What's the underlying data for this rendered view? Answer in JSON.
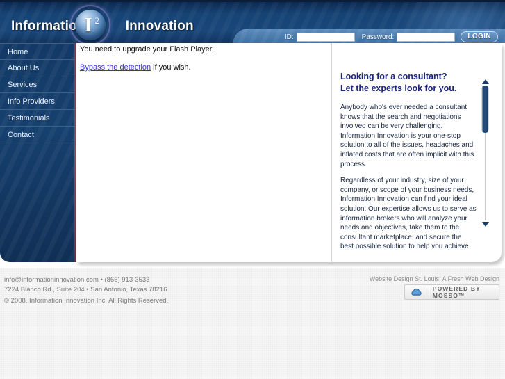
{
  "header": {
    "brand_left": "Information",
    "brand_right": "Innovation",
    "logo_letter": "I",
    "logo_superscript": "2",
    "login": {
      "id_label": "ID:",
      "id_value": "",
      "id_placeholder": "",
      "password_label": "Password:",
      "password_value": "",
      "password_placeholder": "",
      "button_label": "LOGIN"
    }
  },
  "sidebar": {
    "items": [
      {
        "label": "Home"
      },
      {
        "label": "About Us"
      },
      {
        "label": "Services"
      },
      {
        "label": "Info Providers"
      },
      {
        "label": "Testimonials"
      },
      {
        "label": "Contact"
      }
    ]
  },
  "main": {
    "flash_message": "You need to upgrade your Flash Player.",
    "bypass_link": "Bypass the detection",
    "bypass_suffix": " if you wish."
  },
  "panel": {
    "title_line1": "Looking for a consultant?",
    "title_line2": "Let the experts look for you.",
    "paragraphs": [
      "Anybody who's ever needed a consultant knows that the search and negotiations involved can be very challenging. Information Innovation is your one-stop solution to all of the issues, headaches and inflated costs that are often implicit with this process.",
      "Regardless of your industry, size of your company, or scope of your business needs, Information Innovation can find your ideal solution. Our expertise allows us to serve as information brokers who will analyze your needs and objectives, take them to the consultant marketplace, and secure the best possible solution to help you achieve your goals."
    ]
  },
  "footer": {
    "email": "info@informationinnovation.com",
    "contact_line": "info@informationinnovation.com • (866) 913-3533",
    "address_line": "7224 Blanco Rd., Suite 204 • San Antonio, Texas 78216",
    "copyright": "© 2008. Information Innovation Inc. All Rights Reserved.",
    "credit": "Website Design St. Louis: A Fresh Web Design",
    "badge_text": "POWERED BY MOSSO™"
  },
  "colors": {
    "header_blue": "#164374",
    "sidebar_blue": "#16406f",
    "accent_red": "#93484c",
    "panel_title": "#1a237e",
    "link_blue": "#3333cc"
  }
}
